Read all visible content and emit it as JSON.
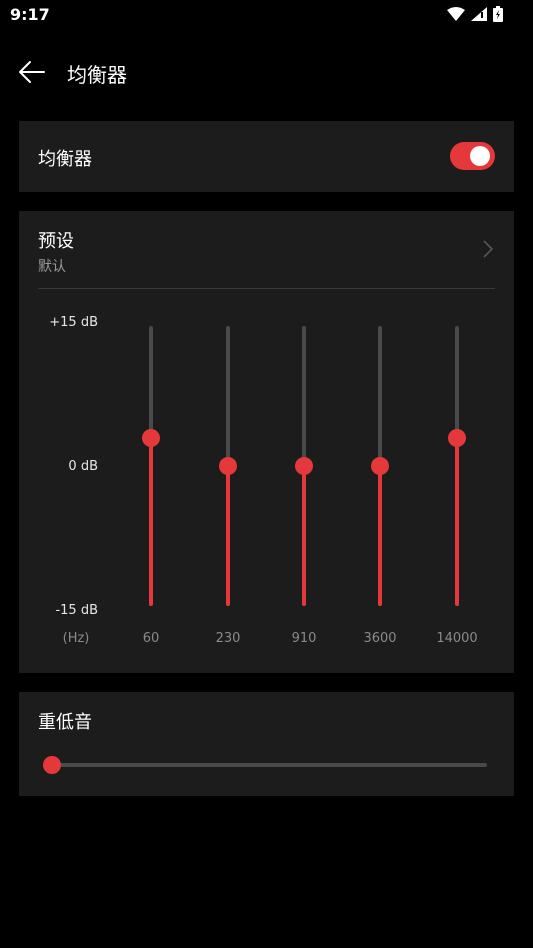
{
  "status_bar": {
    "time": "9:17"
  },
  "app_bar": {
    "title": "均衡器"
  },
  "equalizer": {
    "label": "均衡器",
    "enabled": true
  },
  "preset": {
    "title": "预设",
    "value": "默认"
  },
  "graph": {
    "db_max": "+15 dB",
    "db_zero": "0 dB",
    "db_min": "-15 dB",
    "unit": "(Hz)",
    "bands": [
      {
        "freq": "60",
        "level_db": 3
      },
      {
        "freq": "230",
        "level_db": 0
      },
      {
        "freq": "910",
        "level_db": 0
      },
      {
        "freq": "3600",
        "level_db": 0
      },
      {
        "freq": "14000",
        "level_db": 3
      }
    ]
  },
  "bass": {
    "label": "重低音",
    "level": 0
  },
  "colors": {
    "accent": "#e5383b",
    "card": "#1c1c1c",
    "background": "#000000"
  }
}
